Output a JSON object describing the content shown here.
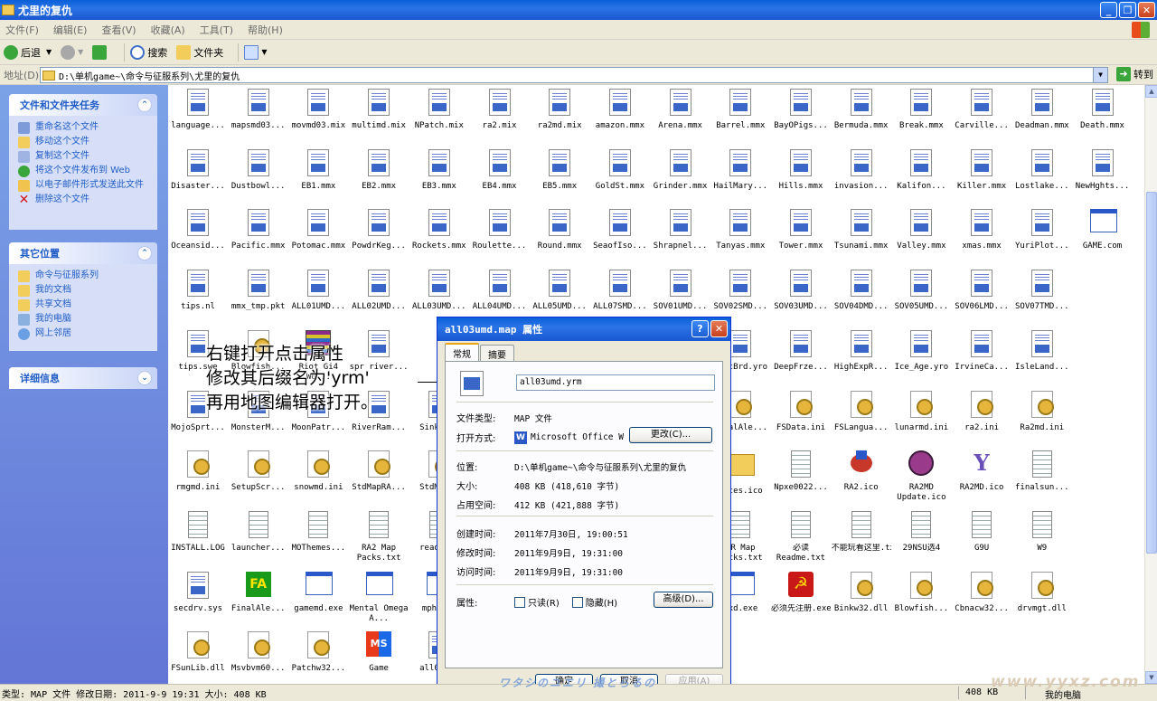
{
  "window": {
    "title": "尤里的复仇",
    "min": "_",
    "max": "❐",
    "close": "✕"
  },
  "menu": [
    "文件(F)",
    "编辑(E)",
    "查看(V)",
    "收藏(A)",
    "工具(T)",
    "帮助(H)"
  ],
  "toolbar": {
    "back": "后退",
    "search": "搜索",
    "folders": "文件夹"
  },
  "address": {
    "label": "地址(D)",
    "path": "D:\\单机game~\\命令与征服系列\\尤里的复仇",
    "go": "转到"
  },
  "tasks": {
    "file_tasks": {
      "title": "文件和文件夹任务",
      "items": [
        "重命名这个文件",
        "移动这个文件",
        "复制这个文件",
        "将这个文件发布到 Web",
        "以电子邮件形式发送此文件",
        "删除这个文件"
      ]
    },
    "other_places": {
      "title": "其它位置",
      "items": [
        "命令与征服系列",
        "我的文档",
        "共享文档",
        "我的电脑",
        "网上邻居"
      ]
    },
    "details": {
      "title": "详细信息"
    }
  },
  "files": [
    [
      "language...",
      "mapsmd03...",
      "movmd03.mix",
      "multimd.mix",
      "NPatch.mix",
      "ra2.mix",
      "ra2md.mix",
      "amazon.mmx",
      "Arena.mmx",
      "Barrel.mmx",
      "BayOPigs...",
      "Bermuda.mmx",
      "Break.mmx",
      "Carville...",
      "Deadman.mmx",
      "Death.mmx"
    ],
    [
      "Disaster...",
      "Dustbowl...",
      "EB1.mmx",
      "EB2.mmx",
      "EB3.mmx",
      "EB4.mmx",
      "EB5.mmx",
      "GoldSt.mmx",
      "Grinder.mmx",
      "HailMary...",
      "Hills.mmx",
      "invasion...",
      "Kalifon...",
      "Killer.mmx",
      "Lostlake...",
      "NewHghts..."
    ],
    [
      "Oceansid...",
      "Pacific.mmx",
      "Potomac.mmx",
      "PowdrKeg...",
      "Rockets.mmx",
      "Roulette...",
      "Round.mmx",
      "SeaofIso...",
      "Shrapnel...",
      "Tanyas.mmx",
      "Tower.mmx",
      "Tsunami.mmx",
      "Valley.mmx",
      "xmas.mmx",
      "YuriPlot...",
      "GAME.com"
    ],
    [
      "tips.nl",
      "mmx_tmp.pkt",
      "ALL01UMD...",
      "ALL02UMD...",
      "ALL03UMD...",
      "ALL04UMD...",
      "ALL05UMD...",
      "ALL07SMD...",
      "SOV01UMD...",
      "SOV02SMD...",
      "SOV03UMD...",
      "SOV04DMD...",
      "SOV05UMD...",
      "SOV06LMD...",
      "SOV07TMD..."
    ],
    [
      "tips.swe",
      "Blowfish...",
      "Riot Gi4 W0...",
      "spr river...",
      "",
      "",
      "",
      "",
      "prings ers.yrm",
      "CrctBrd.yro",
      "DeepFrze...",
      "HighExpR...",
      "Ice_Age.yro",
      "IrvineCa...",
      "IsleLand..."
    ],
    [
      "MojoSprt...",
      "MonsterM...",
      "MoonPatr...",
      "RiverRam...",
      "SinkS...",
      "",
      "",
      "",
      "rtmd...",
      "FinalAle...",
      "FSData.ini",
      "FSLangua...",
      "lunarmd.ini",
      "ra2.ini",
      "Ra2md.ini"
    ],
    [
      "rmgmd.ini",
      "SetupScr...",
      "snowmd.ini",
      "StdMapRA...",
      "StdMa...",
      "",
      "",
      "",
      "ne.ico",
      "notes.ico",
      "Npxe0022...",
      "RA2.ico",
      "RA2MD Update.ico",
      "RA2MD.ico",
      "finalsun..."
    ],
    [
      "INSTALL.LOG",
      "launcher...",
      "MOThemes...",
      "RA2 Map Packs.txt",
      "readm...",
      "",
      "",
      "",
      "astal...",
      "YR Map Packs.txt",
      "必读 Readme.txt",
      "不能玩看这里.txt",
      "29NSU选4",
      "G9U",
      "W9"
    ],
    [
      "secdrv.sys",
      "FinalAle...",
      "gamemd.exe",
      "Mental Omega A...",
      "mphm...",
      "",
      "",
      "",
      "as000...",
      "wxd.exe",
      "必须先注册.exe",
      "Binkw32.dll",
      "Blowfish...",
      "Cbnacw32...",
      "drvmgt.dll"
    ],
    [
      "FSunLib.dll",
      "Msvbvm60...",
      "Patchw32...",
      "Game",
      "all03..."
    ]
  ],
  "annotation": [
    "右键打开点击属性",
    "修改其后缀名为'yrm'",
    "再用地图编辑器打开。"
  ],
  "dialog": {
    "title": "all03umd.map 属性",
    "tabs": [
      "常规",
      "摘要"
    ],
    "filename": "all03umd.yrm",
    "type_label": "文件类型:",
    "type_value": "MAP 文件",
    "open_label": "打开方式:",
    "open_value": "Microsoft Office W",
    "change_btn": "更改(C)...",
    "location_label": "位置:",
    "location_value": "D:\\单机game~\\命令与征服系列\\尤里的复仇",
    "size_label": "大小:",
    "size_value": "408 KB (418,610 字节)",
    "disk_label": "占用空间:",
    "disk_value": "412 KB (421,888 字节)",
    "created_label": "创建时间:",
    "created_value": "2011年7月30日, 19:00:51",
    "modified_label": "修改时间:",
    "modified_value": "2011年9月9日, 19:31:00",
    "accessed_label": "访问时间:",
    "accessed_value": "2011年9月9日, 19:31:00",
    "attr_label": "属性:",
    "readonly": "只读(R)",
    "hidden": "隐藏(H)",
    "advanced": "高级(D)...",
    "ok": "确定",
    "cancel": "取消",
    "apply": "应用(A)"
  },
  "status": {
    "text": "类型: MAP 文件 修改日期: 2011-9-9 19:31 大小: 408 KB",
    "size": "408 KB",
    "zone": "我的电脑"
  },
  "watermarks": {
    "left": "ワタシのユエリ 撮とらるの",
    "right": "www.yyxz.com"
  }
}
